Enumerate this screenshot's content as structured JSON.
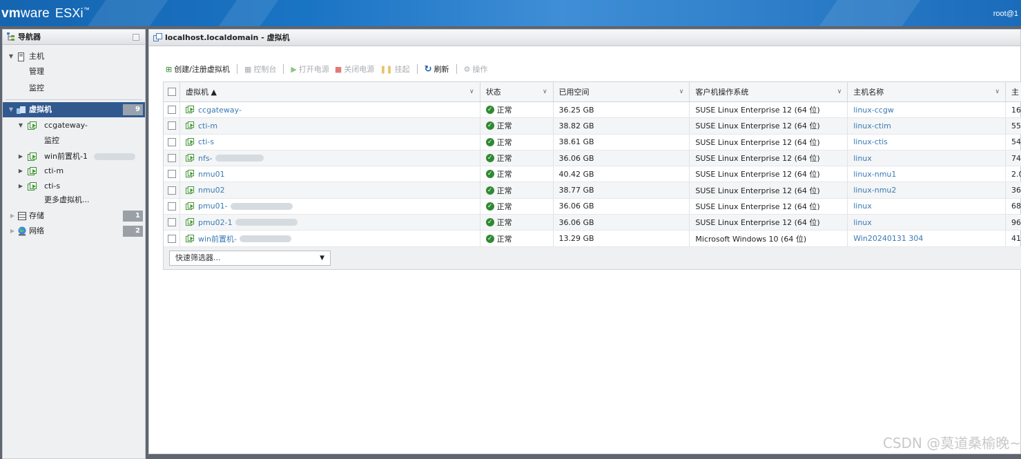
{
  "app": {
    "brand_vm": "vm",
    "brand_ware": "ware",
    "product": "ESXi",
    "product_mark": "™",
    "user": "root@1"
  },
  "navigator": {
    "title": "导航器",
    "items": [
      {
        "label": "主机",
        "level": 0,
        "arrow": "▼"
      },
      {
        "label": "管理",
        "level": 2
      },
      {
        "label": "监控",
        "level": 2
      },
      {
        "label": "虚拟机",
        "level": 0,
        "arrow": "▼",
        "badge": "9",
        "selected": true
      },
      {
        "label": "ccgateway-",
        "level": 1,
        "arrow": "▼"
      },
      {
        "label": "监控",
        "level": 2
      },
      {
        "label": "win前置机-1",
        "level": 1,
        "arrow": "▶"
      },
      {
        "label": "cti-m",
        "level": 1,
        "arrow": "▶"
      },
      {
        "label": "cti-s",
        "level": 1,
        "arrow": "▶"
      },
      {
        "label": "更多虚拟机...",
        "level": 2
      },
      {
        "label": "存储",
        "level": 0,
        "arrow": "▶",
        "badge": "1"
      },
      {
        "label": "网络",
        "level": 0,
        "arrow": "▶",
        "badge": "2"
      }
    ]
  },
  "main": {
    "title": "localhost.localdomain - 虚拟机",
    "toolbar": {
      "create": "创建/注册虚拟机",
      "console": "控制台",
      "power_on": "打开电源",
      "power_off": "关闭电源",
      "suspend": "挂起",
      "refresh": "刷新",
      "actions": "操作"
    },
    "columns": [
      "虚拟机 ▲",
      "状态",
      "已用空间",
      "客户机操作系统",
      "主机名称",
      "主"
    ],
    "rows": [
      {
        "vm": "ccgateway-",
        "status": "正常",
        "space": "36.25 GB",
        "os": "SUSE Linux Enterprise 12 (64 位)",
        "host": "linux-ccgw",
        "extra": "16"
      },
      {
        "vm": "cti-m",
        "status": "正常",
        "space": "38.82 GB",
        "os": "SUSE Linux Enterprise 12 (64 位)",
        "host": "linux-ctim",
        "extra": "55"
      },
      {
        "vm": "cti-s",
        "status": "正常",
        "space": "38.61 GB",
        "os": "SUSE Linux Enterprise 12 (64 位)",
        "host": "linux-ctis",
        "extra": "54"
      },
      {
        "vm": "nfs-",
        "status": "正常",
        "space": "36.06 GB",
        "os": "SUSE Linux Enterprise 12 (64 位)",
        "host": "linux",
        "extra": "74"
      },
      {
        "vm": "nmu01",
        "status": "正常",
        "space": "40.42 GB",
        "os": "SUSE Linux Enterprise 12 (64 位)",
        "host": "linux-nmu1",
        "extra": "2.0"
      },
      {
        "vm": "nmu02",
        "status": "正常",
        "space": "38.77 GB",
        "os": "SUSE Linux Enterprise 12 (64 位)",
        "host": "linux-nmu2",
        "extra": "36"
      },
      {
        "vm": "pmu01-",
        "status": "正常",
        "space": "36.06 GB",
        "os": "SUSE Linux Enterprise 12 (64 位)",
        "host": "linux",
        "extra": "68"
      },
      {
        "vm": "pmu02-1",
        "status": "正常",
        "space": "36.06 GB",
        "os": "SUSE Linux Enterprise 12 (64 位)",
        "host": "linux",
        "extra": "96"
      },
      {
        "vm": "win前置机-",
        "status": "正常",
        "space": "13.29 GB",
        "os": "Microsoft Windows 10 (64 位)",
        "host": "Win20240131 304",
        "extra": "41"
      }
    ],
    "quick_filter": "快速筛选器...",
    "quick_filter_arrow": "▼"
  },
  "watermark": "CSDN @莫道桑榆晚~",
  "colors": {
    "accent": "#1a6cbb",
    "selected": "#31598f",
    "link": "#3a79b4",
    "ok": "#2e8a32"
  }
}
